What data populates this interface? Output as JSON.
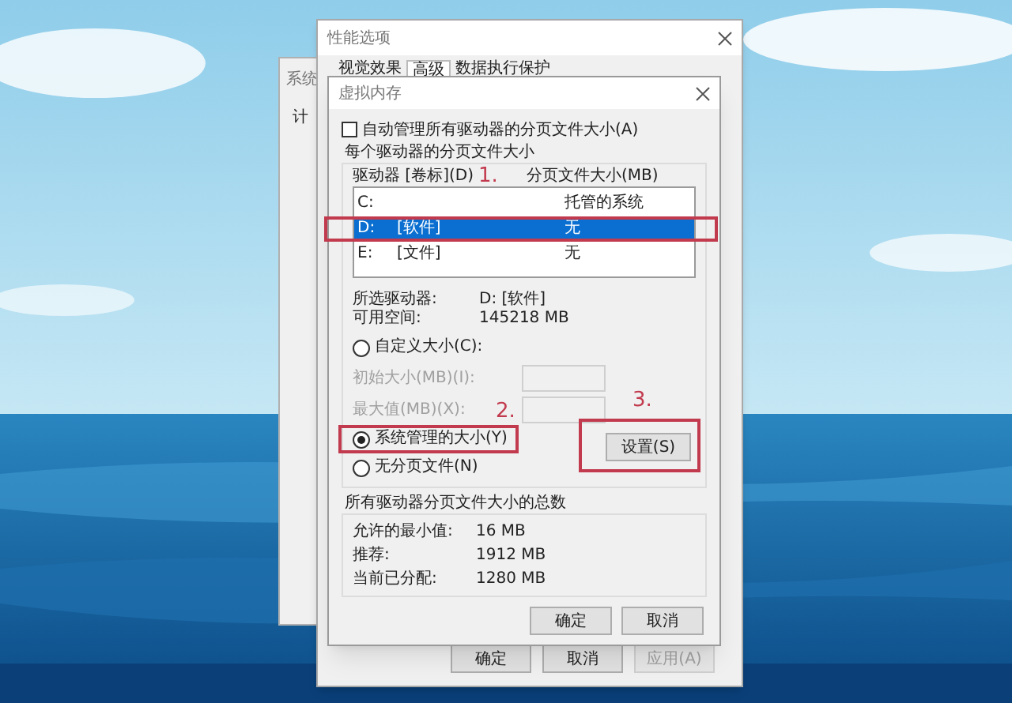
{
  "system_window": {
    "title": "系统",
    "tab": "计"
  },
  "performance_options": {
    "title": "性能选项",
    "tabs": [
      {
        "label": "视觉效果",
        "selected": false
      },
      {
        "label": "高级",
        "selected": true
      },
      {
        "label": "数据执行保护",
        "selected": false
      }
    ],
    "buttons": [
      {
        "label": "确定",
        "disabled": false
      },
      {
        "label": "取消",
        "disabled": false
      },
      {
        "label": "应用(A)",
        "disabled": true
      }
    ]
  },
  "virtual_memory": {
    "title": "虚拟内存",
    "auto_manage": {
      "label": "自动管理所有驱动器的分页文件大小(A)",
      "checked": false
    },
    "per_drive": {
      "title": "每个驱动器的分页文件大小",
      "columns": [
        "驱动器 [卷标](D)",
        "分页文件大小(MB)"
      ],
      "drives": [
        {
          "drive": "C:",
          "size": "托管的系统",
          "selected": false
        },
        {
          "drive": "D:",
          "label": "[软件]",
          "size": "无",
          "selected": true
        },
        {
          "drive": "E:",
          "label": "[文件]",
          "size": "无",
          "selected": false
        }
      ],
      "selected_drive": {
        "label": "所选驱动器:",
        "value": "D:  [软件]"
      },
      "free_space": {
        "label": "可用空间:",
        "value": "145218 MB"
      },
      "options": [
        {
          "kind": "radio",
          "label": "自定义大小(C):",
          "selected": false
        },
        {
          "kind": "field",
          "label": "初始大小(MB)(I):",
          "disabled": true
        },
        {
          "kind": "field",
          "label": "最大值(MB)(X):",
          "disabled": true
        },
        {
          "kind": "radio",
          "label": "系统管理的大小(Y)",
          "selected": true
        },
        {
          "kind": "radio",
          "label": "无分页文件(N)",
          "selected": false
        }
      ],
      "set_button": "设置(S)"
    },
    "totals": {
      "title": "所有驱动器分页文件大小的总数",
      "rows": [
        {
          "label": "允许的最小值:",
          "value": "16 MB"
        },
        {
          "label": "推荐:",
          "value": "1912 MB"
        },
        {
          "label": "当前已分配:",
          "value": "1280 MB"
        }
      ]
    },
    "buttons": [
      "确定",
      "取消"
    ]
  },
  "annotations": [
    "1.",
    "2.",
    "3."
  ]
}
